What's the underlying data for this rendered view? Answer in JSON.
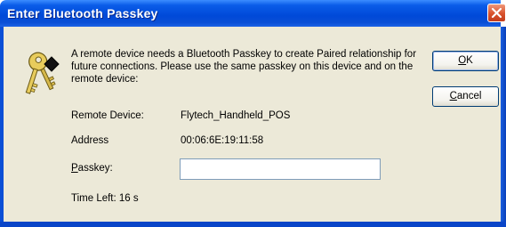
{
  "window": {
    "title": "Enter Bluetooth Passkey"
  },
  "message": {
    "text": "A remote device needs a Bluetooth Passkey to create Paired relationship for future connections. Please use the same passkey on this device and on the remote device:"
  },
  "buttons": {
    "ok_accel": "O",
    "ok_rest": "K",
    "cancel_accel": "C",
    "cancel_rest": "ancel"
  },
  "fields": {
    "remote_device_label": "Remote Device:",
    "remote_device_value": "Flytech_Handheld_POS",
    "address_label": "Address",
    "address_value": "00:06:6E:19:11:58",
    "passkey_label_accel": "P",
    "passkey_label_rest": "asskey:",
    "passkey_value": ""
  },
  "status": {
    "time_left": "Time Left: 16 s"
  },
  "icons": {
    "dialog_icon": "keys-icon",
    "close": "close-icon"
  },
  "colors": {
    "titlebar": "#0049d8",
    "client_bg": "#ece9d8",
    "close_button": "#d8522c",
    "button_border": "#003c74"
  }
}
